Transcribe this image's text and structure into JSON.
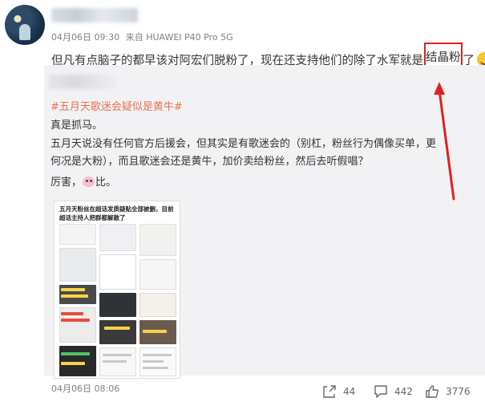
{
  "post": {
    "date": "04月06日 09:30",
    "source": "来自 HUAWEI P40 Pro 5G",
    "text_before": "但凡有点脑子的都早该对阿宏们脱粉了，现在还支持他们的除了水军就是",
    "text_highlight": "结晶粉",
    "text_after": "了",
    "emoji_icon": "hugging-emoji-icon"
  },
  "repost": {
    "topic": "#五月天歌迷会疑似是黄牛#",
    "line1": "真是抓马。",
    "line2": "五月天说没有任何官方后援会，但其实是有歌迷会的（别杠，粉丝行为偶像买单，更何况是大粉），而且歌迷会还是黄牛，加价卖给粉丝，然后去听假唱？",
    "line3_a": "厉害，",
    "line3_b": "比。",
    "image_title": "五月天粉丝在超话发质疑贴全部被删，目前超话主持人把群都解散了",
    "time": "04月06日 08:06"
  },
  "actions": {
    "share_count": "44",
    "comment_count": "442",
    "like_count": "3776"
  },
  "colors": {
    "topic": "#eb7350",
    "highlight": "#e02020",
    "repost_bg": "#f2f2f5"
  }
}
